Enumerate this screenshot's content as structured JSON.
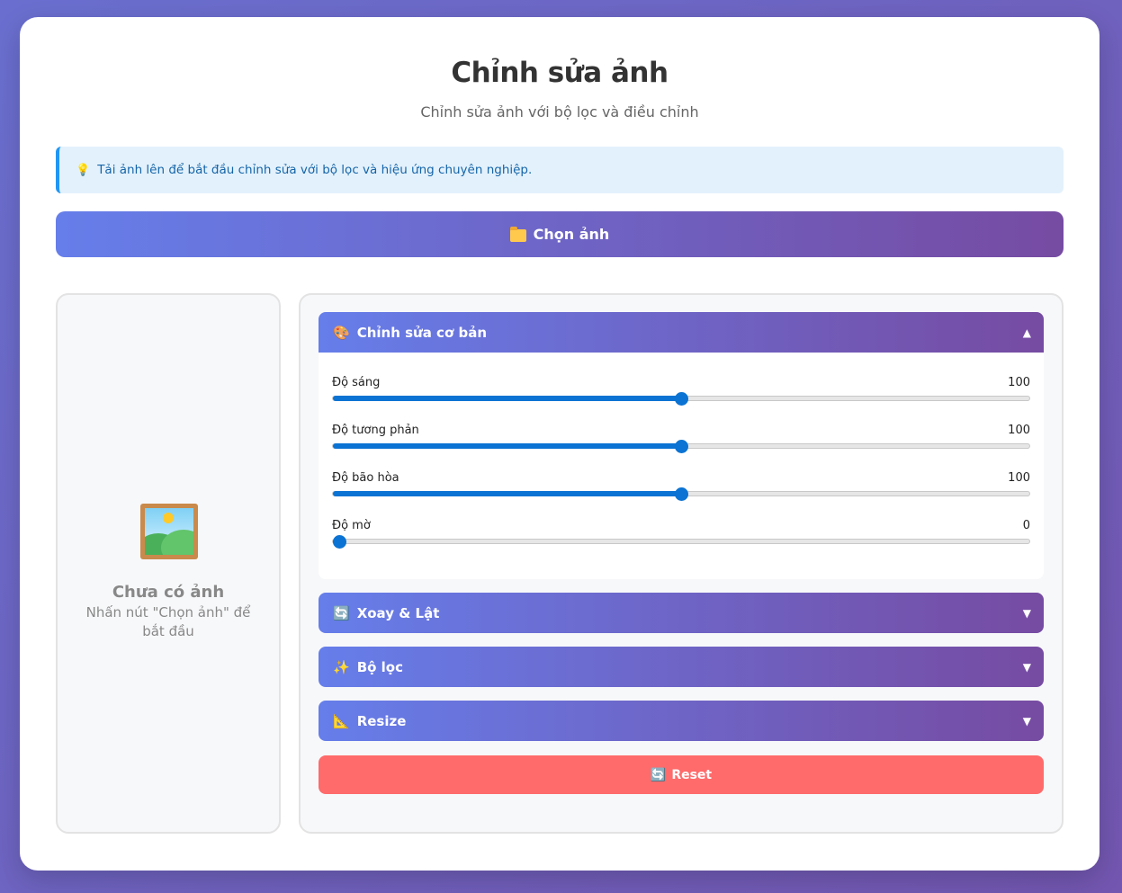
{
  "header": {
    "title": "Chỉnh sửa ảnh",
    "subtitle": "Chỉnh sửa ảnh với bộ lọc và điều chỉnh"
  },
  "info": {
    "icon": "lightbulb-icon",
    "text": "Tải ảnh lên để bắt đầu chỉnh sửa với bộ lọc và hiệu ứng chuyên nghiệp."
  },
  "upload": {
    "icon": "folder-icon",
    "label": "Chọn ảnh"
  },
  "preview": {
    "icon": "framed-picture-icon",
    "empty_title": "Chưa có ảnh",
    "empty_hint": "Nhấn nút \"Chọn ảnh\" để bắt đầu"
  },
  "sections": {
    "basic": {
      "icon": "palette-icon",
      "emoji": "🎨",
      "title": "Chỉnh sửa cơ bản",
      "expanded": true,
      "sliders": [
        {
          "label": "Độ sáng",
          "value": "100",
          "fraction": 0.5
        },
        {
          "label": "Độ tương phản",
          "value": "100",
          "fraction": 0.5
        },
        {
          "label": "Độ bão hòa",
          "value": "100",
          "fraction": 0.5
        },
        {
          "label": "Độ mờ",
          "value": "0",
          "fraction": 0.0
        }
      ]
    },
    "rotate": {
      "icon": "refresh-icon",
      "emoji": "🔄",
      "title": "Xoay & Lật",
      "expanded": false
    },
    "filters": {
      "icon": "sparkles-icon",
      "emoji": "✨",
      "title": "Bộ lọc",
      "expanded": false
    },
    "resize": {
      "icon": "triangle-ruler-icon",
      "emoji": "📐",
      "title": "Resize",
      "expanded": false
    }
  },
  "reset": {
    "icon": "refresh-icon",
    "emoji": "🔄",
    "label": "Reset"
  },
  "colors": {
    "gradient_start": "#667eea",
    "gradient_end": "#764ba2",
    "reset": "#ff6b6b",
    "slider": "#0b73d3",
    "info_bg": "#e3f1fc"
  }
}
